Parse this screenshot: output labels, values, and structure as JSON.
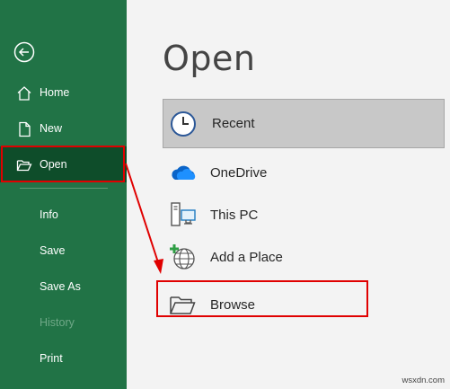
{
  "sidebar": {
    "back_icon": "back-arrow-icon",
    "items": [
      {
        "label": "Home",
        "icon": "home-icon"
      },
      {
        "label": "New",
        "icon": "new-document-icon"
      },
      {
        "label": "Open",
        "icon": "open-folder-icon",
        "selected": true
      },
      {
        "label": "Info"
      },
      {
        "label": "Save"
      },
      {
        "label": "Save As"
      },
      {
        "label": "History",
        "disabled": true
      },
      {
        "label": "Print"
      }
    ]
  },
  "main": {
    "title": "Open",
    "locations": [
      {
        "label": "Recent",
        "icon": "clock-icon",
        "selected": true
      },
      {
        "label": "OneDrive",
        "icon": "onedrive-cloud-icon"
      },
      {
        "label": "This PC",
        "icon": "computer-icon"
      },
      {
        "label": "Add a Place",
        "icon": "globe-add-icon"
      },
      {
        "label": "Browse",
        "icon": "folder-icon"
      }
    ]
  },
  "watermark": "wsxdn.com",
  "colors": {
    "sidebar_bg": "#217346",
    "sidebar_selected": "#0e4d2a",
    "highlight": "#e00000"
  }
}
